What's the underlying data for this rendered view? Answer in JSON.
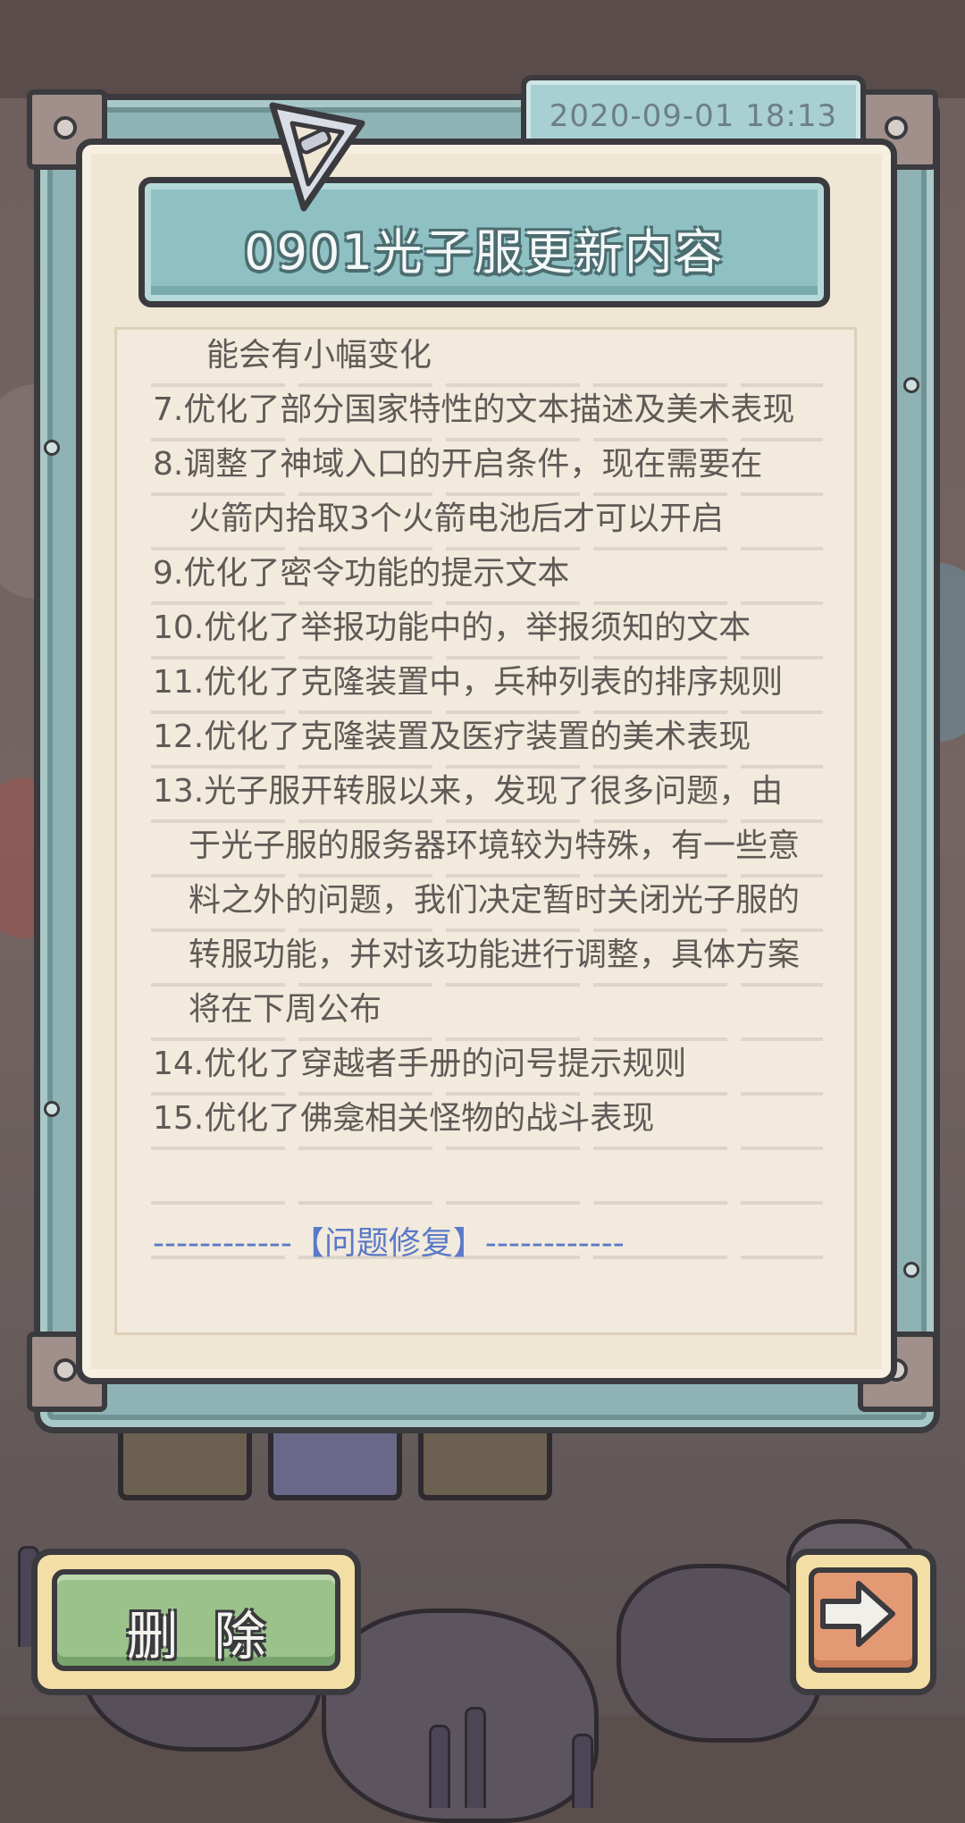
{
  "notice": {
    "date": "2020-09-01  18:13",
    "title": "0901光子服更新内容",
    "lines": [
      "能会有小幅变化",
      "7.优化了部分国家特性的文本描述及美术表现",
      "8.调整了神域入口的开启条件，现在需要在",
      "火箭内拾取3个火箭电池后才可以开启",
      "9.优化了密令功能的提示文本",
      "10.优化了举报功能中的，举报须知的文本",
      "11.优化了克隆装置中，兵种列表的排序规则",
      "12.优化了克隆装置及医疗装置的美术表现",
      "13.光子服开转服以来，发现了很多问题，由",
      "于光子服的服务器环境较为特殊，有一些意",
      "料之外的问题，我们决定暂时关闭光子服的",
      "转服功能，并对该功能进行调整，具体方案",
      "将在下周公布",
      "14.优化了穿越者手册的问号提示规则",
      "15.优化了佛龛相关怪物的战斗表现"
    ],
    "section_header": "------------【问题修复】------------"
  },
  "buttons": {
    "delete_label": "删除",
    "next_icon": "right-arrow-icon"
  },
  "colors": {
    "frame": "#8fb3b4",
    "paper": "#f0e6d4",
    "title_plate": "#8fc1c4",
    "text": "#5f5a57",
    "section_text": "#5a79c8",
    "delete_button": "#9cc28c",
    "next_button": "#e39a74"
  }
}
